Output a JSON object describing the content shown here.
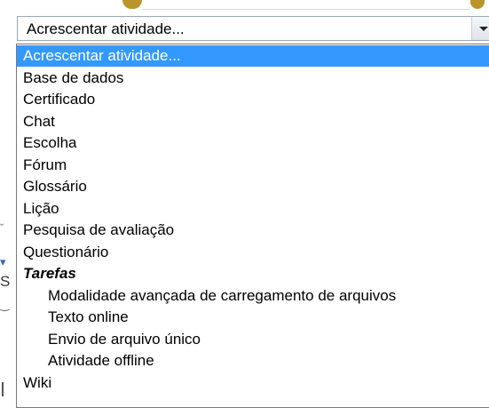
{
  "select": {
    "value": "Acrescentar atividade...",
    "arrow_icon": "chevron-down-icon"
  },
  "options": [
    {
      "label": "Acrescentar atividade...",
      "selected": true
    },
    {
      "label": "Base de dados"
    },
    {
      "label": "Certificado"
    },
    {
      "label": "Chat"
    },
    {
      "label": "Escolha"
    },
    {
      "label": "Fórum"
    },
    {
      "label": "Glossário"
    },
    {
      "label": "Lição"
    },
    {
      "label": "Pesquisa de avaliação"
    },
    {
      "label": "Questionário"
    },
    {
      "label": "Tarefas",
      "group": true
    },
    {
      "label": "Modalidade avançada de carregamento de arquivos",
      "indent": true
    },
    {
      "label": "Texto online",
      "indent": true
    },
    {
      "label": "Envio de arquivo único",
      "indent": true
    },
    {
      "label": "Atividade offline",
      "indent": true
    },
    {
      "label": "Wiki"
    }
  ],
  "colors": {
    "highlight": "#3399ff",
    "border": "#7a7a7a"
  }
}
